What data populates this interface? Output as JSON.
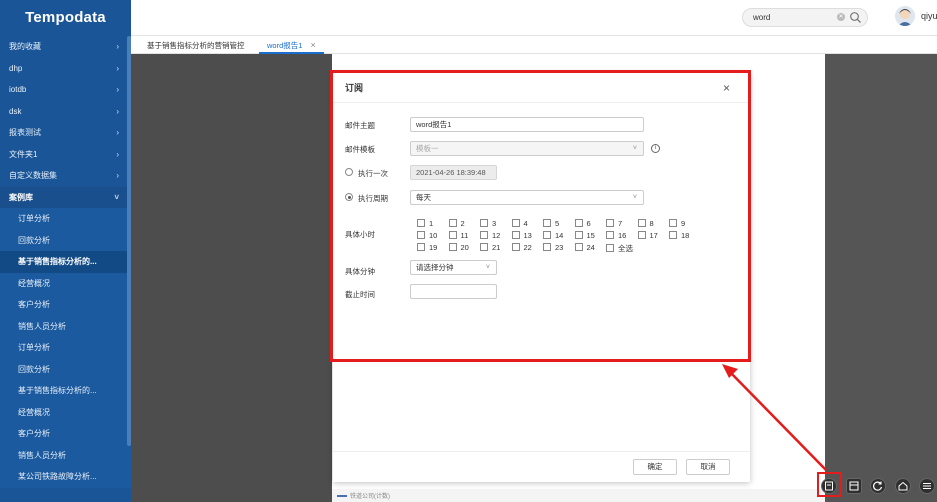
{
  "app": {
    "logo": "Tempodata"
  },
  "sidebar": {
    "items": [
      {
        "label": "我的收藏",
        "chevron": "›",
        "kind": "top"
      },
      {
        "label": "dhp",
        "chevron": "›",
        "kind": "top"
      },
      {
        "label": "iotdb",
        "chevron": "›",
        "kind": "top"
      },
      {
        "label": "dsk",
        "chevron": "›",
        "kind": "top"
      },
      {
        "label": "报表测试",
        "chevron": "›",
        "kind": "top"
      },
      {
        "label": "文件夹1",
        "chevron": "›",
        "kind": "top"
      },
      {
        "label": "自定义数据集",
        "chevron": "›",
        "kind": "top"
      },
      {
        "label": "案例库",
        "chevron": "˅",
        "kind": "open"
      },
      {
        "label": "订单分析",
        "kind": "sub"
      },
      {
        "label": "回款分析",
        "kind": "sub"
      },
      {
        "label": "基于销售指标分析的...",
        "kind": "sub-active"
      },
      {
        "label": "经营概况",
        "kind": "sub"
      },
      {
        "label": "客户分析",
        "kind": "sub"
      },
      {
        "label": "销售人员分析",
        "kind": "sub"
      },
      {
        "label": "订单分析",
        "kind": "sub"
      },
      {
        "label": "回款分析",
        "kind": "sub"
      },
      {
        "label": "基于销售指标分析的...",
        "kind": "sub"
      },
      {
        "label": "经营概况",
        "kind": "sub"
      },
      {
        "label": "客户分析",
        "kind": "sub"
      },
      {
        "label": "销售人员分析",
        "kind": "sub"
      },
      {
        "label": "某公司铁路故障分析...",
        "kind": "sub"
      }
    ]
  },
  "topbar": {
    "search_value": "word",
    "username": "qiyu"
  },
  "tabs": [
    {
      "label": "基于销售指标分析的营销管控"
    },
    {
      "label": "word报告1",
      "close": "×"
    }
  ],
  "legend": {
    "text": "铁道公司(计数)"
  },
  "modal": {
    "title": "订阅",
    "close": "×",
    "subject_label": "邮件主题",
    "subject_value": "word报告1",
    "template_label": "邮件模板",
    "template_placeholder": "模板一",
    "once_label": "执行一次",
    "once_value": "2021-04-26 18:39:48",
    "period_label": "执行周期",
    "period_value": "每天",
    "hour_label": "具体小时",
    "hours": [
      "1",
      "2",
      "3",
      "4",
      "5",
      "6",
      "7",
      "8",
      "9",
      "10",
      "11",
      "12",
      "13",
      "14",
      "15",
      "16",
      "17",
      "18",
      "19",
      "20",
      "21",
      "22",
      "23",
      "24",
      "全选"
    ],
    "minute_label": "具体分钟",
    "minute_placeholder": "请选择分钟",
    "deadline_label": "截止时间",
    "confirm": "确定",
    "cancel": "取消"
  },
  "colors": {
    "sidebar": "#1a5697",
    "accent": "#1a6fce",
    "annotation": "#e41c1c"
  }
}
